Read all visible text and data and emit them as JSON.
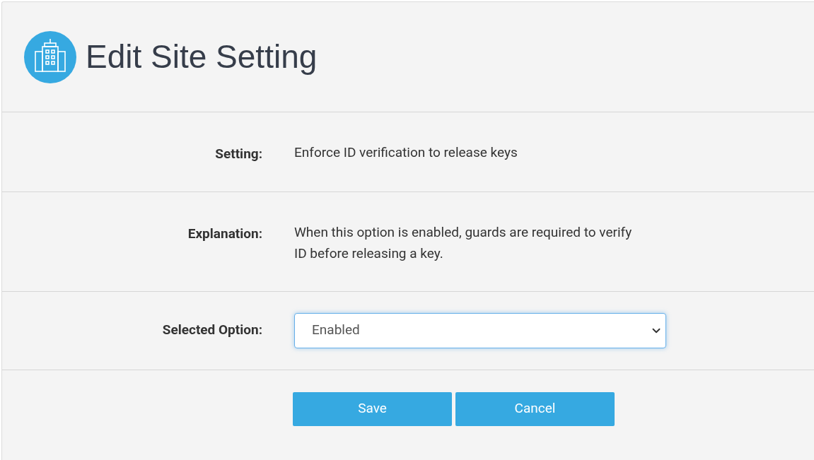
{
  "title": "Edit Site Setting",
  "fields": [
    {
      "kind": "text",
      "label": "Setting:",
      "value": "Enforce ID verification to release keys"
    },
    {
      "kind": "text",
      "label": "Explanation:",
      "value": "When this option is enabled, guards are required to verify ID before releasing a key."
    },
    {
      "kind": "select",
      "label": "Selected Option:",
      "value": "Enabled"
    }
  ],
  "buttons": [
    "Save",
    "Cancel"
  ]
}
